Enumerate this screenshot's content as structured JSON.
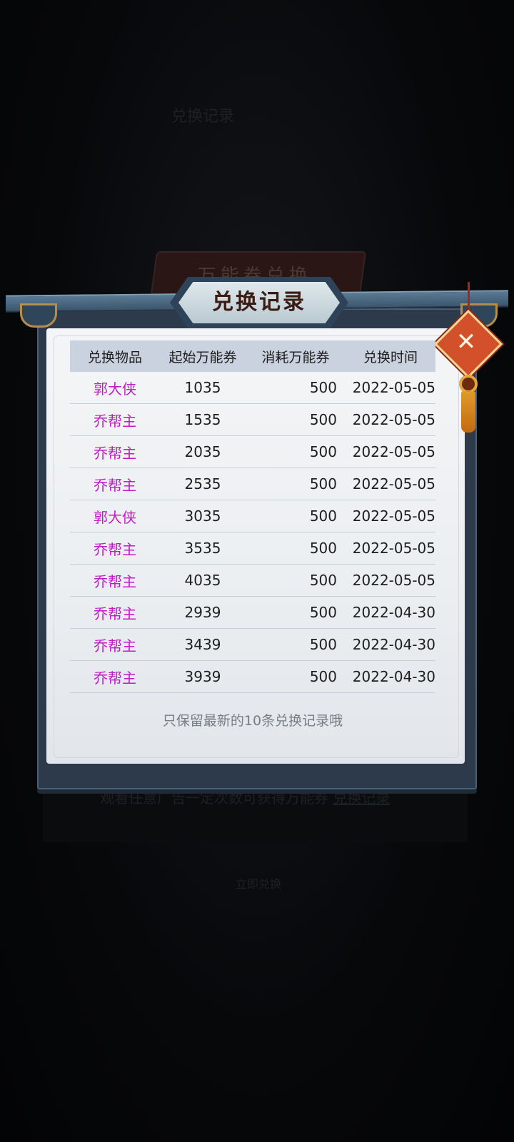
{
  "background": {
    "faint_top_text": "兑换记录",
    "faint_tab_text": "万能券兑换",
    "faint_hint": "观看任意广告一定次数可获得万能券",
    "faint_hint_link": "兑换记录",
    "faint_bottom_text": "立即兑换"
  },
  "dialog": {
    "title": "兑换记录",
    "close_icon": "close-x-icon",
    "headers": [
      "兑换物品",
      "起始万能券",
      "消耗万能券",
      "兑换时间"
    ],
    "rows": [
      {
        "item": "郭大侠",
        "start": "1035",
        "cost": "500",
        "time": "2022-05-05"
      },
      {
        "item": "乔帮主",
        "start": "1535",
        "cost": "500",
        "time": "2022-05-05"
      },
      {
        "item": "乔帮主",
        "start": "2035",
        "cost": "500",
        "time": "2022-05-05"
      },
      {
        "item": "乔帮主",
        "start": "2535",
        "cost": "500",
        "time": "2022-05-05"
      },
      {
        "item": "郭大侠",
        "start": "3035",
        "cost": "500",
        "time": "2022-05-05"
      },
      {
        "item": "乔帮主",
        "start": "3535",
        "cost": "500",
        "time": "2022-05-05"
      },
      {
        "item": "乔帮主",
        "start": "4035",
        "cost": "500",
        "time": "2022-05-05"
      },
      {
        "item": "乔帮主",
        "start": "2939",
        "cost": "500",
        "time": "2022-04-30"
      },
      {
        "item": "乔帮主",
        "start": "3439",
        "cost": "500",
        "time": "2022-04-30"
      },
      {
        "item": "乔帮主",
        "start": "3939",
        "cost": "500",
        "time": "2022-04-30"
      }
    ],
    "footnote": "只保留最新的10条兑换记录哦"
  },
  "colors": {
    "item_name": "#c21cc7",
    "header_bg": "#c9d2de",
    "close_button": "#d2502a"
  }
}
